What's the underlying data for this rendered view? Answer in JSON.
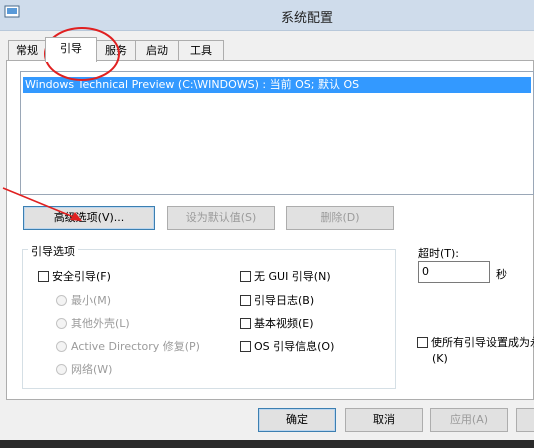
{
  "window": {
    "title": "系统配置"
  },
  "tabs": [
    {
      "label": "常规"
    },
    {
      "label": "引导",
      "active": true
    },
    {
      "label": "服务"
    },
    {
      "label": "启动"
    },
    {
      "label": "工具"
    }
  ],
  "os_list": {
    "entries": [
      "Windows Technical Preview (C:\\WINDOWS) : 当前 OS; 默认 OS"
    ]
  },
  "boot_buttons": {
    "advanced": "高级选项(V)...",
    "set_default": "设为默认值(S)",
    "delete": "删除(D)"
  },
  "boot_options": {
    "legend": "引导选项",
    "safe_boot": {
      "label": "安全引导(F)",
      "checked": false
    },
    "safe_modes": [
      "最小(M)",
      "其他外壳(L)",
      "Active Directory 修复(P)",
      "网络(W)"
    ],
    "right_checks": [
      {
        "label": "无 GUI 引导(N)",
        "checked": false
      },
      {
        "label": "引导日志(B)",
        "checked": false
      },
      {
        "label": "基本视频(E)",
        "checked": false
      },
      {
        "label": "OS 引导信息(O)",
        "checked": false
      }
    ]
  },
  "timeout": {
    "label": "超时(T):",
    "value": "0",
    "unit": "秒"
  },
  "permanent": {
    "label_line1": "使所有引导设置成为永",
    "label_line2": "(K)",
    "checked": false
  },
  "dialog_buttons": {
    "ok": "确定",
    "cancel": "取消",
    "apply": "应用(A)"
  },
  "colors": {
    "selection": "#3399ff",
    "annotation": "#e02020",
    "titlebar": "#cfdceb"
  }
}
